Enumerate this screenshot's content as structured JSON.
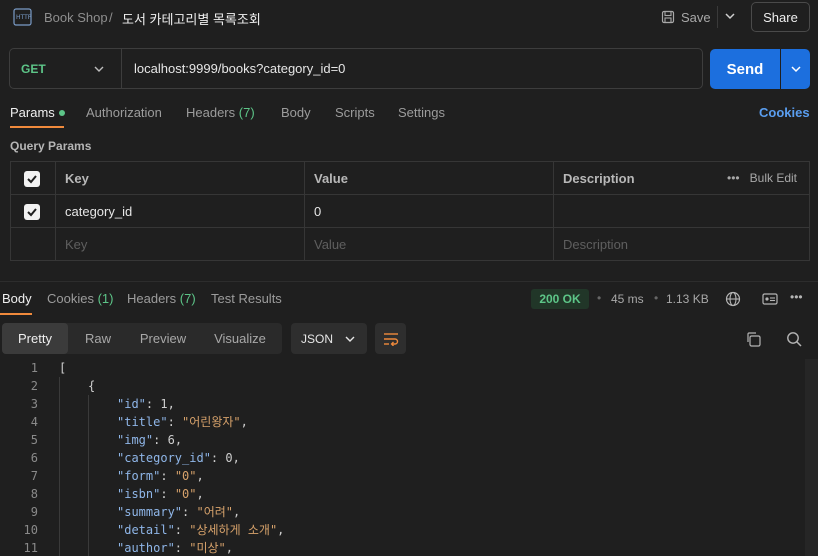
{
  "header": {
    "breadcrumb_parent": "Book Shop",
    "breadcrumb_separator": "/",
    "request_name": "도서 카테고리별 목록조회",
    "save_label": "Save",
    "share_label": "Share"
  },
  "request": {
    "method": "GET",
    "url": "localhost:9999/books?category_id=0",
    "send_label": "Send"
  },
  "request_tabs": {
    "params": "Params",
    "authorization": "Authorization",
    "headers_label": "Headers",
    "headers_count": "(7)",
    "body": "Body",
    "scripts": "Scripts",
    "settings": "Settings",
    "cookies": "Cookies"
  },
  "query_params": {
    "label": "Query Params",
    "columns": {
      "key": "Key",
      "value": "Value",
      "description": "Description"
    },
    "bulk_edit": "Bulk Edit",
    "rows": [
      {
        "key": "category_id",
        "value": "0",
        "checked": true
      }
    ],
    "placeholder": {
      "key": "Key",
      "value": "Value",
      "description": "Description"
    }
  },
  "response_tabs": {
    "body": "Body",
    "cookies_label": "Cookies",
    "cookies_count": "(1)",
    "headers_label": "Headers",
    "headers_count": "(7)",
    "test_results": "Test Results"
  },
  "response_meta": {
    "status": "200 OK",
    "time": "45 ms",
    "size": "1.13 KB"
  },
  "response_view": {
    "modes": [
      "Pretty",
      "Raw",
      "Preview",
      "Visualize"
    ],
    "active_mode": "Pretty",
    "format": "JSON"
  },
  "code_lines": [
    {
      "n": "1",
      "indent": 0,
      "parts": [
        [
          "punc",
          "["
        ]
      ]
    },
    {
      "n": "2",
      "indent": 1,
      "parts": [
        [
          "punc",
          "{"
        ]
      ]
    },
    {
      "n": "3",
      "indent": 2,
      "parts": [
        [
          "key",
          "\"id\""
        ],
        [
          "punc",
          ": "
        ],
        [
          "num",
          "1"
        ],
        [
          "punc",
          ","
        ]
      ]
    },
    {
      "n": "4",
      "indent": 2,
      "parts": [
        [
          "key",
          "\"title\""
        ],
        [
          "punc",
          ": "
        ],
        [
          "str",
          "\"어린왕자\""
        ],
        [
          "punc",
          ","
        ]
      ]
    },
    {
      "n": "5",
      "indent": 2,
      "parts": [
        [
          "key",
          "\"img\""
        ],
        [
          "punc",
          ": "
        ],
        [
          "num",
          "6"
        ],
        [
          "punc",
          ","
        ]
      ]
    },
    {
      "n": "6",
      "indent": 2,
      "parts": [
        [
          "key",
          "\"category_id\""
        ],
        [
          "punc",
          ": "
        ],
        [
          "num",
          "0"
        ],
        [
          "punc",
          ","
        ]
      ]
    },
    {
      "n": "7",
      "indent": 2,
      "parts": [
        [
          "key",
          "\"form\""
        ],
        [
          "punc",
          ": "
        ],
        [
          "str",
          "\"0\""
        ],
        [
          "punc",
          ","
        ]
      ]
    },
    {
      "n": "8",
      "indent": 2,
      "parts": [
        [
          "key",
          "\"isbn\""
        ],
        [
          "punc",
          ": "
        ],
        [
          "str",
          "\"0\""
        ],
        [
          "punc",
          ","
        ]
      ]
    },
    {
      "n": "9",
      "indent": 2,
      "parts": [
        [
          "key",
          "\"summary\""
        ],
        [
          "punc",
          ": "
        ],
        [
          "str",
          "\"어려\""
        ],
        [
          "punc",
          ","
        ]
      ]
    },
    {
      "n": "10",
      "indent": 2,
      "parts": [
        [
          "key",
          "\"detail\""
        ],
        [
          "punc",
          ": "
        ],
        [
          "str",
          "\"상세하게 소개\""
        ],
        [
          "punc",
          ","
        ]
      ]
    },
    {
      "n": "11",
      "indent": 2,
      "parts": [
        [
          "key",
          "\"author\""
        ],
        [
          "punc",
          ": "
        ],
        [
          "str",
          "\"미상\""
        ],
        [
          "punc",
          ","
        ]
      ]
    }
  ]
}
